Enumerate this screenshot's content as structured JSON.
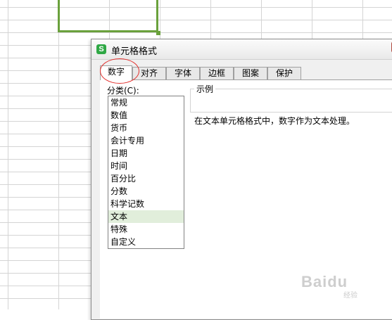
{
  "dialog": {
    "title": "单元格格式",
    "app_icon_letter": "S",
    "tabs": [
      {
        "label": "数字",
        "active": true
      },
      {
        "label": "对齐"
      },
      {
        "label": "字体"
      },
      {
        "label": "边框"
      },
      {
        "label": "图案"
      },
      {
        "label": "保护"
      }
    ],
    "category_label": "分类(C):",
    "categories": [
      "常规",
      "数值",
      "货币",
      "会计专用",
      "日期",
      "时间",
      "百分比",
      "分数",
      "科学记数",
      "文本",
      "特殊",
      "自定义"
    ],
    "selected_category": "文本",
    "sample_label": "示例",
    "description": "在文本单元格格式中，数字作为文本处理。"
  },
  "watermark": {
    "text": "Baidu",
    "sub": "经验"
  },
  "colors": {
    "cell_border": "#6aa13c",
    "highlight_circle": "#e2312e",
    "selected_row": "#e1eedb"
  }
}
